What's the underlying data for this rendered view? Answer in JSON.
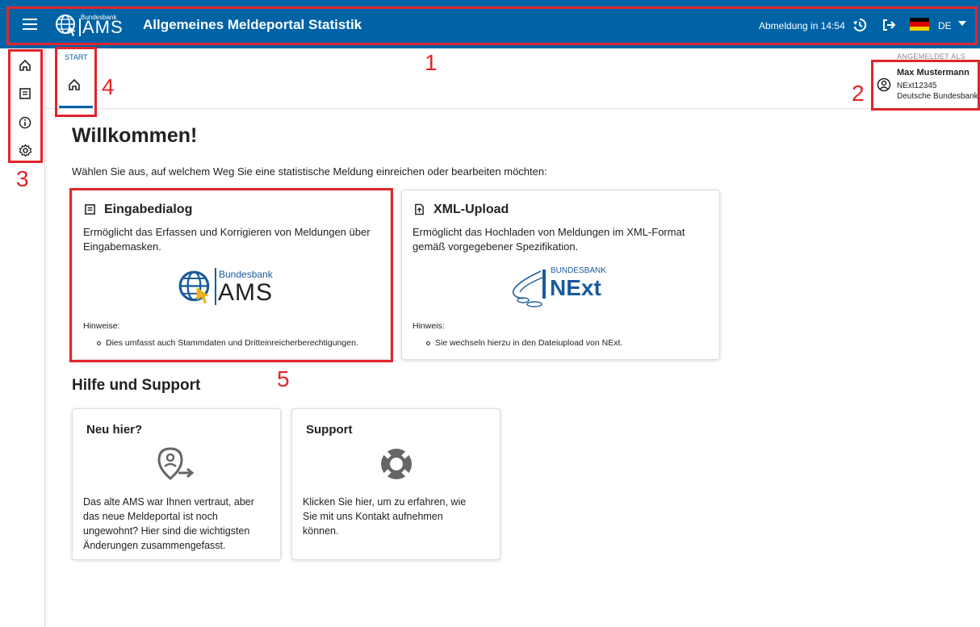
{
  "topbar": {
    "logo_small": "Bundesbank",
    "logo_big": "AMS",
    "title": "Allgemeines Meldeportal Statistik",
    "logout_timer": "Abmeldung in 14:54",
    "language": "DE",
    "icons": [
      "menu-icon",
      "history-icon",
      "logout-icon",
      "flag-de-icon"
    ],
    "colors": {
      "bar": "#0063a6"
    }
  },
  "sidebar": {
    "items": [
      "home-icon",
      "form-icon",
      "info-icon",
      "settings-icon"
    ]
  },
  "tabs": {
    "label": "START",
    "active_icon": "home-icon"
  },
  "user": {
    "logged_as_label": "ANGEMELDET ALS",
    "name": "Max Mustermann",
    "id": "NExt12345",
    "org": "Deutsche Bundesbank"
  },
  "main": {
    "welcome": "Willkommen!",
    "intro": "Wählen Sie aus, auf welchem Weg Sie eine statistische Meldung einreichen oder bearbeiten möchten:",
    "cards": [
      {
        "title": "Eingabedialog",
        "desc_line1": "Ermöglicht das Erfassen und Korrigieren von Meldungen über",
        "desc_line2": "Eingabemasken.",
        "logo_small": "Bundesbank",
        "logo_big": "AMS",
        "hint_label": "Hinweise:",
        "hint": "Dies umfasst auch Stammdaten und Dritteinreicherberechtigungen."
      },
      {
        "title": "XML-Upload",
        "desc_line1": "Ermöglicht das Hochladen von Meldungen im XML-Format",
        "desc_line2": "gemäß vorgegebener Spezifikation.",
        "logo_small": "BUNDESBANK",
        "logo_big": "NExt",
        "hint_label": "Hinweis:",
        "hint": "Sie wechseln hierzu in den Dateiupload von NExt."
      }
    ],
    "help_title": "Hilfe und Support",
    "help_cards": [
      {
        "title": "Neu hier?",
        "lines": [
          "Das alte AMS war Ihnen vertraut, aber",
          "das neue Meldeportal ist noch",
          "ungewohnt? Hier sind die wichtigsten",
          "Änderungen zusammengefasst."
        ]
      },
      {
        "title": "Support",
        "lines": [
          "Klicken Sie hier, um zu erfahren, wie",
          "Sie mit uns Kontakt aufnehmen",
          "können."
        ]
      }
    ]
  },
  "annotations": [
    "1",
    "2",
    "3",
    "4",
    "5"
  ]
}
